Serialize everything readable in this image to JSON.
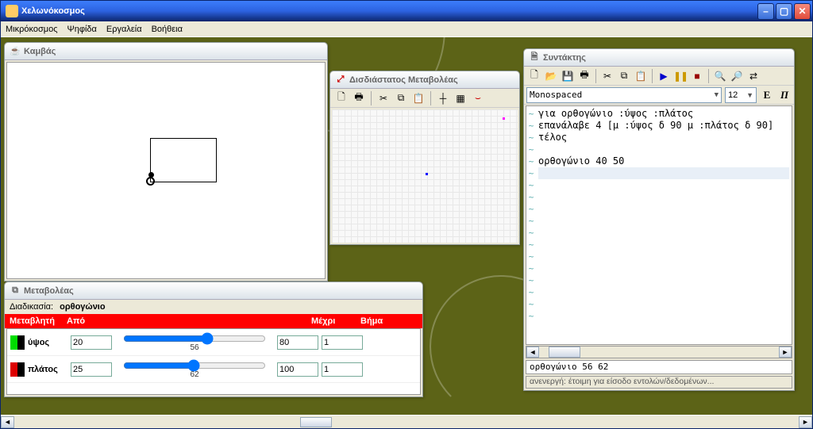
{
  "window": {
    "title": "Χελωνόκοσμος"
  },
  "menu": {
    "m1": "Μικρόκοσμος",
    "m2": "Ψηφίδα",
    "m3": "Εργαλεία",
    "m4": "Βοήθεια"
  },
  "canvas": {
    "title": "Καμβάς"
  },
  "slider2d": {
    "title": "Δισδιάστατος Μεταβολέας"
  },
  "varpanel": {
    "title": "Μεταβολέας",
    "proc_label": "Διαδικασία:",
    "proc_name": "ορθογώνιο",
    "hdr_var": "Μεταβλητή",
    "hdr_from": "Από",
    "hdr_to": "Μέχρι",
    "hdr_step": "Βήμα",
    "rows": [
      {
        "name": "ύψος",
        "from": "20",
        "to": "80",
        "step": "1",
        "val": "56"
      },
      {
        "name": "πλάτος",
        "from": "25",
        "to": "100",
        "step": "1",
        "val": "62"
      }
    ]
  },
  "editor": {
    "title": "Συντάκτης",
    "font": "Monospaced",
    "size": "12",
    "lines": [
      "για ορθογώνιο :ύψος :πλάτος",
      "επανάλαβε 4 [μ :ύψος δ 90 μ :πλάτος δ 90]",
      "τέλος",
      "",
      "ορθογώνιο 40 50"
    ],
    "output": "ορθογώνιο 56 62",
    "status": "ανενεργή: έτοιμη για είσοδο εντολών/δεδομένων..."
  }
}
